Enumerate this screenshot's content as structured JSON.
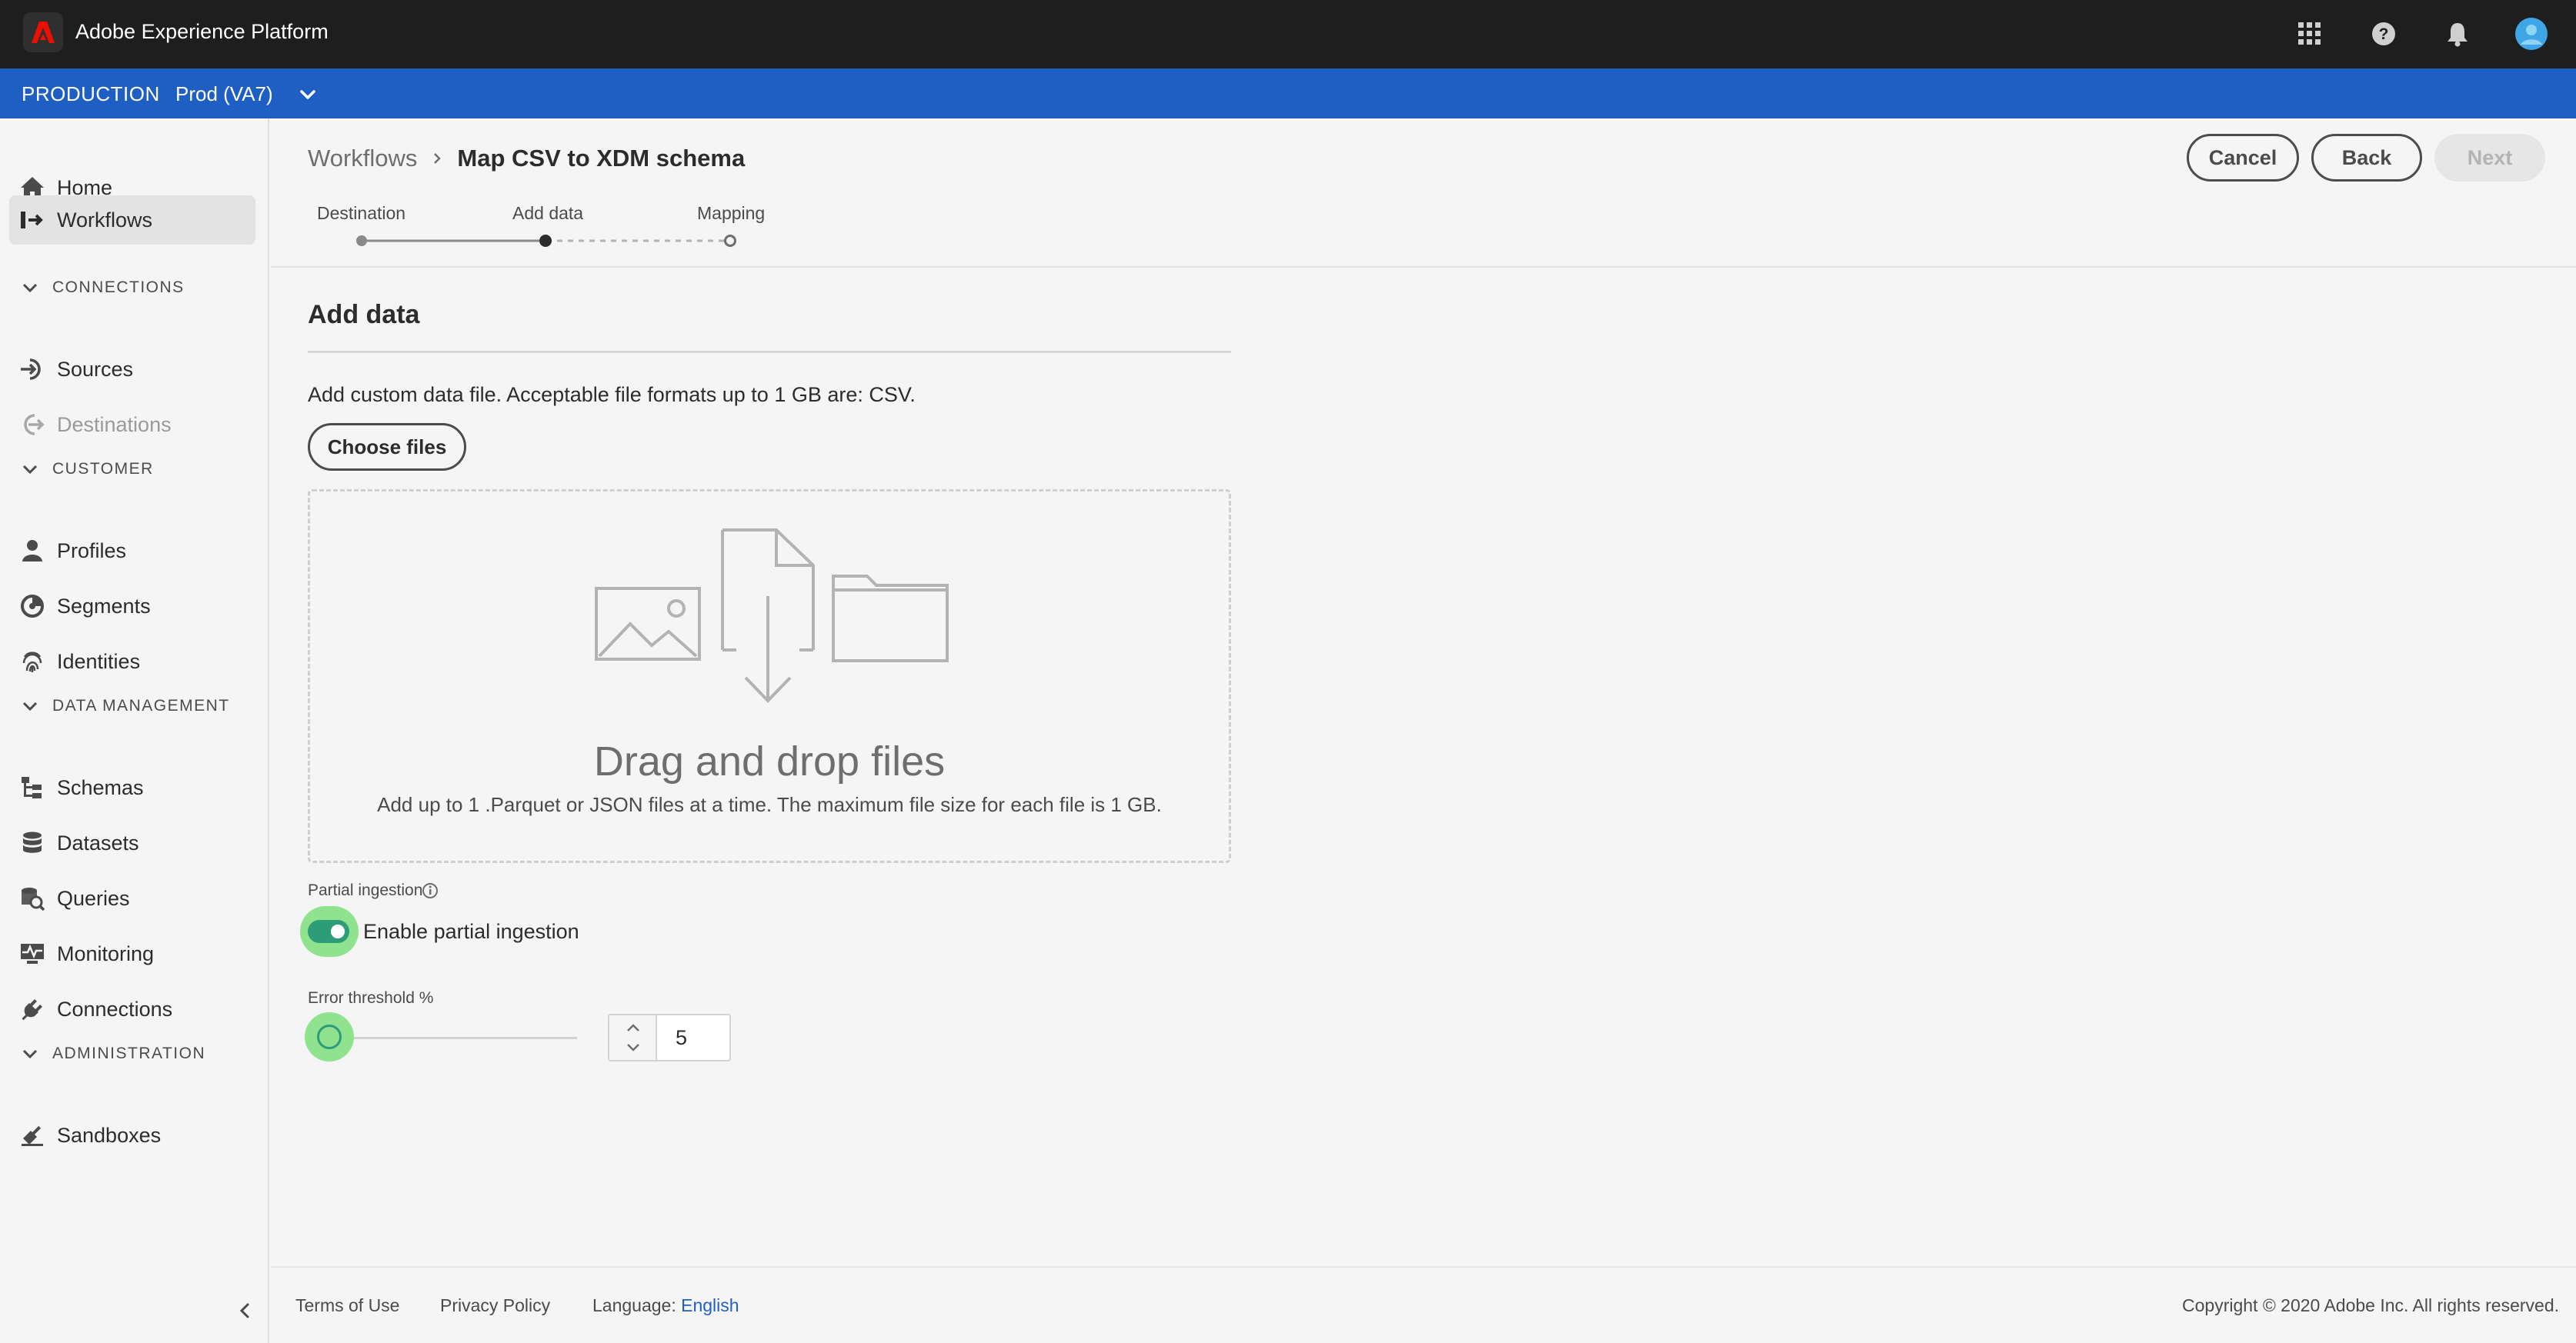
{
  "app": {
    "title": "Adobe Experience Platform"
  },
  "org": {
    "name": "PRODUCTION",
    "sandbox": "Prod (VA7)"
  },
  "sidebar": {
    "items": [
      {
        "label": "Home",
        "icon": "home-icon"
      },
      {
        "label": "Workflows",
        "icon": "workflows-icon",
        "active": true
      },
      {
        "label": "Sources",
        "icon": "sources-icon"
      },
      {
        "label": "Destinations",
        "icon": "destinations-icon",
        "disabled": true
      },
      {
        "label": "Profiles",
        "icon": "profile-icon"
      },
      {
        "label": "Segments",
        "icon": "segments-icon"
      },
      {
        "label": "Identities",
        "icon": "fingerprint-icon"
      },
      {
        "label": "Schemas",
        "icon": "schema-icon"
      },
      {
        "label": "Datasets",
        "icon": "database-icon"
      },
      {
        "label": "Queries",
        "icon": "queries-icon"
      },
      {
        "label": "Monitoring",
        "icon": "monitoring-icon"
      },
      {
        "label": "Connections",
        "icon": "plug-icon"
      },
      {
        "label": "Sandboxes",
        "icon": "sandbox-icon"
      }
    ],
    "sections": [
      "CONNECTIONS",
      "CUSTOMER",
      "DATA MANAGEMENT",
      "ADMINISTRATION"
    ]
  },
  "breadcrumb": {
    "parent": "Workflows",
    "current": "Map CSV to XDM schema"
  },
  "actions": {
    "cancel": "Cancel",
    "back": "Back",
    "next": "Next"
  },
  "steps": [
    {
      "label": "Destination",
      "state": "complete"
    },
    {
      "label": "Add data",
      "state": "current"
    },
    {
      "label": "Mapping",
      "state": "upcoming"
    }
  ],
  "content": {
    "title": "Add data",
    "description": "Add custom data file. Acceptable file formats up to 1 GB are: CSV.",
    "choose_files": "Choose files",
    "dropzone_title": "Drag and drop files",
    "dropzone_subtitle": "Add up to 1 .Parquet or JSON files at a time. The maximum file size for each file is 1 GB.",
    "partial_ingestion_label": "Partial ingestion",
    "toggle_label": "Enable partial ingestion",
    "toggle_on": true,
    "error_threshold_label": "Error threshold %",
    "error_threshold_value": "5"
  },
  "footer": {
    "terms": "Terms of Use",
    "privacy": "Privacy Policy",
    "language_label": "Language:",
    "language_value": "English",
    "copyright": "Copyright ©  2020 Adobe Inc.  All rights reserved."
  },
  "colors": {
    "brand_red": "#eb1000",
    "org_bar": "#1f5fc3",
    "toggle_green": "#2d9d78",
    "highlight": "#8fe38f"
  }
}
